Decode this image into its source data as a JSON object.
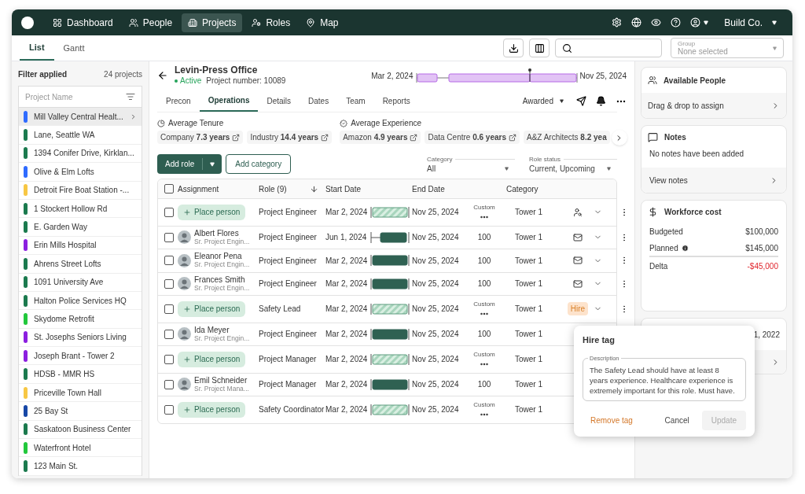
{
  "nav": {
    "items": [
      {
        "label": "Dashboard",
        "selected": false
      },
      {
        "label": "People",
        "selected": false
      },
      {
        "label": "Projects",
        "selected": true
      },
      {
        "label": "Roles",
        "selected": false
      },
      {
        "label": "Map",
        "selected": false
      }
    ],
    "company": "Build Co."
  },
  "view_tabs": [
    {
      "label": "List",
      "selected": true
    },
    {
      "label": "Gantt",
      "selected": false
    }
  ],
  "group_select": {
    "label": "Group",
    "placeholder": "None selected"
  },
  "sidebar": {
    "filter": "Filter applied",
    "count": "24 projects",
    "search_placeholder": "Project Name",
    "items": [
      {
        "name": "Mill Valley Central Healt...",
        "color": "#2f6bff",
        "selected": true
      },
      {
        "name": "Lane, Seattle WA",
        "color": "#1b7a4e",
        "selected": false
      },
      {
        "name": "1394 Conifer Drive, Kirklan...",
        "color": "#1b7a4e",
        "selected": false
      },
      {
        "name": "Olive & Elm Lofts",
        "color": "#2f6bff",
        "selected": false
      },
      {
        "name": "Detroit Fire Boat Station -...",
        "color": "#f7c744",
        "selected": false
      },
      {
        "name": "1 Stockert Hollow Rd",
        "color": "#1b7a4e",
        "selected": false
      },
      {
        "name": "E. Garden Way",
        "color": "#1b7a4e",
        "selected": false
      },
      {
        "name": "Erin Mills Hospital",
        "color": "#8b1fe0",
        "selected": false
      },
      {
        "name": "Ahrens Street Lofts",
        "color": "#1b7a4e",
        "selected": false
      },
      {
        "name": "1091 University Ave",
        "color": "#1b7a4e",
        "selected": false
      },
      {
        "name": "Halton Police Services HQ",
        "color": "#1b7a4e",
        "selected": false
      },
      {
        "name": "Skydome Retrofit",
        "color": "#22c83c",
        "selected": false
      },
      {
        "name": "St. Josephs Seniors Living",
        "color": "#8b1fe0",
        "selected": false
      },
      {
        "name": "Joseph Brant - Tower 2",
        "color": "#8b1fe0",
        "selected": false
      },
      {
        "name": "HDSB - MMR HS",
        "color": "#1b7a4e",
        "selected": false
      },
      {
        "name": "Priceville Town Hall",
        "color": "#f7c744",
        "selected": false
      },
      {
        "name": "25 Bay St",
        "color": "#1747a6",
        "selected": false
      },
      {
        "name": "Saskatoon Business Center",
        "color": "#1b7a4e",
        "selected": false
      },
      {
        "name": "Waterfront Hotel",
        "color": "#22c83c",
        "selected": false
      },
      {
        "name": "123 Main St.",
        "color": "#1b7a4e",
        "selected": false
      }
    ]
  },
  "project": {
    "title": "Levin-Press Office",
    "status": "Active",
    "number": "Project number: 10089",
    "start": "Mar 2, 2024",
    "end": "Nov 25, 2024",
    "stage": "Awarded"
  },
  "tabs": [
    {
      "label": "Precon",
      "selected": false
    },
    {
      "label": "Operations",
      "selected": true
    },
    {
      "label": "Details",
      "selected": false
    },
    {
      "label": "Dates",
      "selected": false
    },
    {
      "label": "Team",
      "selected": false
    },
    {
      "label": "Reports",
      "selected": false
    }
  ],
  "stats": [
    {
      "title": "Average Tenure",
      "chips": [
        "Company **7.3 years**",
        "Industry **14.4 years**"
      ]
    },
    {
      "title": "Average Experience",
      "chips": [
        "Amazon **4.9 years**",
        "Data Centre **0.6 years**",
        "A&Z Architects **8.2 yea**"
      ]
    }
  ],
  "toolbar": {
    "add_role": "Add role",
    "add_category": "Add category",
    "filters": [
      {
        "label": "Category",
        "value": "All"
      },
      {
        "label": "Role status",
        "value": "Current, Upcoming"
      }
    ]
  },
  "table": {
    "all_checked": false,
    "columns": [
      "Assignment",
      "Role (9)",
      "Start Date",
      "End Date",
      "Category"
    ],
    "rows": [
      {
        "kind": "open",
        "checked": false,
        "action_label": "Place person",
        "role": "Project Engineer",
        "start": "Mar 2, 2024",
        "end": "Nov 25, 2024",
        "allocation": "Custom",
        "category": "Tower 1",
        "action": {
          "kind": "find"
        },
        "offset": false
      },
      {
        "kind": "person",
        "checked": false,
        "name": "Albert Flores",
        "title": "Sr. Project Engin...",
        "role": "Project Engineer",
        "start": "Jun 1, 2024",
        "end": "Nov 25, 2024",
        "allocation": "100",
        "category": "Tower 1",
        "action": {
          "kind": "mail"
        },
        "offset": true
      },
      {
        "kind": "person",
        "checked": false,
        "name": "Eleanor Pena",
        "title": "Sr. Project Engin...",
        "role": "Project Engineer",
        "start": "Mar 2, 2024",
        "end": "Nov 25, 2024",
        "allocation": "100",
        "category": "Tower 1",
        "action": {
          "kind": "mail"
        },
        "offset": false
      },
      {
        "kind": "person",
        "checked": false,
        "name": "Frances Smith",
        "title": "Sr. Project Engin...",
        "role": "Project Engineer",
        "start": "Mar 2, 2024",
        "end": "Nov 25, 2024",
        "allocation": "100",
        "category": "Tower 1",
        "action": {
          "kind": "mail"
        },
        "offset": false
      },
      {
        "kind": "open",
        "checked": false,
        "action_label": "Place person",
        "role": "Safety Lead",
        "start": "Mar 2, 2024",
        "end": "Nov 25, 2024",
        "allocation": "Custom",
        "category": "Tower 1",
        "action": {
          "kind": "tag",
          "label": "Hire"
        },
        "offset": false
      },
      {
        "kind": "person",
        "checked": false,
        "name": "Ida Meyer",
        "title": "Sr. Project Engin...",
        "role": "Project Engineer",
        "start": "Mar 2, 2024",
        "end": "Nov 25, 2024",
        "allocation": "100",
        "category": "Tower 1",
        "offset": false
      },
      {
        "kind": "open",
        "checked": false,
        "action_label": "Place person",
        "role": "Project Manager",
        "start": "Mar 2, 2024",
        "end": "Nov 25, 2024",
        "allocation": "Custom",
        "category": "Tower 1",
        "offset": false
      },
      {
        "kind": "person",
        "checked": false,
        "name": "Emil Schneider",
        "title": "Sr. Project Mana...",
        "role": "Project Manager",
        "start": "Mar 2, 2024",
        "end": "Nov 25, 2024",
        "allocation": "100",
        "category": "Tower 1",
        "offset": false
      },
      {
        "kind": "open",
        "checked": false,
        "action_label": "Place person",
        "role": "Safety Coordinator",
        "start": "Mar 2, 2024",
        "end": "Nov 25, 2024",
        "allocation": "Custom",
        "category": "Tower 1",
        "offset": false
      }
    ]
  },
  "panel": {
    "people": {
      "title": "Available People",
      "link": "Drag & drop to assign"
    },
    "notes": {
      "title": "Notes",
      "empty": "No notes have been added",
      "link": "View notes"
    },
    "cost": {
      "title": "Workforce cost",
      "rows": [
        {
          "label": "Budgeted",
          "value": "$100,000",
          "kind": "plain"
        },
        {
          "label": "Planned",
          "value": "$145,000",
          "kind": "info"
        },
        {
          "label": "Delta",
          "value": "-$45,000",
          "kind": "negative"
        }
      ]
    },
    "date_card": {
      "value": "1, 2022"
    }
  },
  "popover": {
    "title": "Hire tag",
    "field_label": "Description",
    "text": "The Safety Lead should have at least 8 years experience. Healthcare experience is extremely important for this role. Must have.",
    "remove": "Remove tag",
    "cancel": "Cancel",
    "update": "Update",
    "update_disabled": true
  }
}
